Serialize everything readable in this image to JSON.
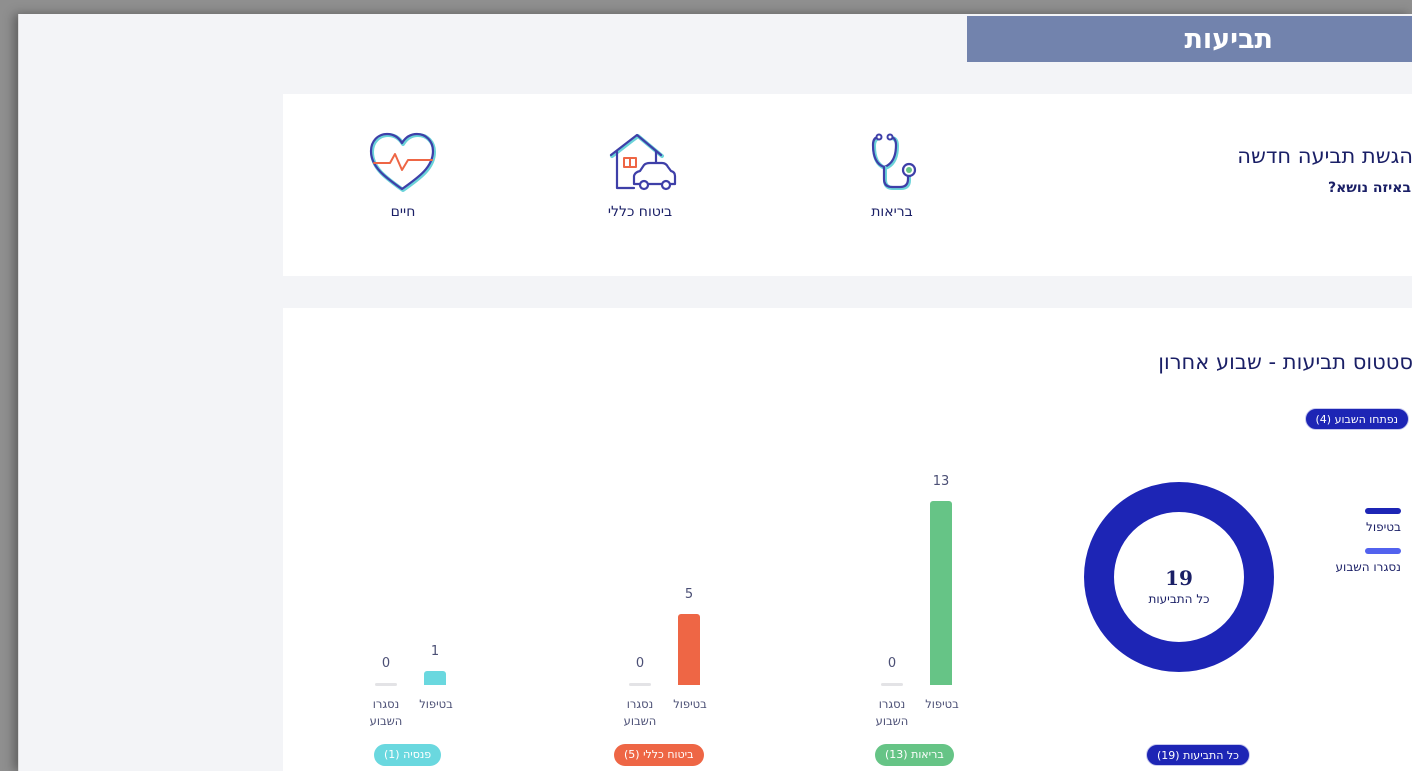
{
  "page": {
    "title": "תביעות"
  },
  "new_claim": {
    "title": "הגשת תביעה חדשה",
    "subtitle": "באיזה נושא?",
    "topics": [
      {
        "label": "בריאות",
        "icon": "stethoscope-icon"
      },
      {
        "label": "ביטוח כללי",
        "icon": "house-car-icon"
      },
      {
        "label": "חיים",
        "icon": "heart-pulse-icon"
      }
    ]
  },
  "status": {
    "title": "סטטוס תביעות - שבוע אחרון",
    "opened_badge": "נפתחו השבוע (4)",
    "legend": [
      {
        "label": "בטיפול",
        "color": "#1d25b5"
      },
      {
        "label": "נסגרו השבוע",
        "color": "#5262ee"
      }
    ],
    "total": {
      "value": "19",
      "label": "כל התביעות",
      "badge": "כל התביעות (19)"
    },
    "groups": [
      {
        "badge": "בריאות (13)",
        "color": "#66c486",
        "in_treatment": {
          "label": "בטיפול",
          "value": "13"
        },
        "closed": {
          "label": "נסגרו השבוע",
          "value": "0"
        }
      },
      {
        "badge": "ביטוח כללי (5)",
        "color": "#ee6645",
        "in_treatment": {
          "label": "בטיפול",
          "value": "5"
        },
        "closed": {
          "label": "נסגרו השבוע",
          "value": "0"
        }
      },
      {
        "badge": "פנסיה (1)",
        "color": "#6ad8df",
        "in_treatment": {
          "label": "בטיפול",
          "value": "1"
        },
        "closed": {
          "label": "נסגרו השבוע",
          "value": "0"
        }
      }
    ]
  },
  "chart_data": {
    "type": "bar",
    "categories": [
      "בריאות",
      "ביטוח כללי",
      "פנסיה"
    ],
    "series": [
      {
        "name": "בטיפול",
        "values": [
          13,
          5,
          1
        ]
      },
      {
        "name": "נסגרו השבוע",
        "values": [
          0,
          0,
          0
        ]
      }
    ],
    "donut": {
      "total": 19,
      "in_treatment": 19,
      "closed": 0
    }
  }
}
